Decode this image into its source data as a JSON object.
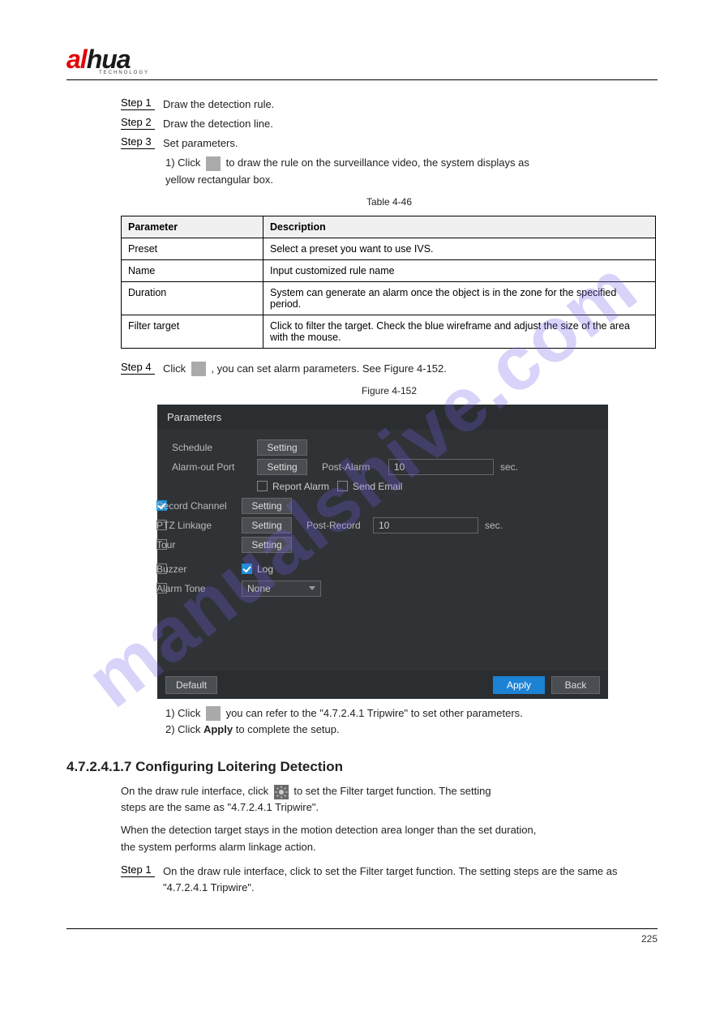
{
  "logo": {
    "brand": "alhua",
    "tagline": "TECHNOLOGY"
  },
  "watermark": "manualshive.com",
  "intro_steps": {
    "s1": {
      "n": "Step 1",
      "text": "Draw the detection rule."
    },
    "s2": {
      "n": "Step 2",
      "text": "Draw the detection line."
    },
    "s3": {
      "n": "Step 3",
      "text": "Set parameters."
    }
  },
  "icon_draw_instruction_prefix": "1)  Click ",
  "icon_draw_instruction_suffix": " to draw the rule on the surveillance video, the system displays as",
  "yellow_line": "yellow rectangular box.",
  "table_caption": "Table 4-46",
  "table": {
    "headers": {
      "param": "Parameter",
      "desc": "Description"
    },
    "rows": [
      {
        "param": "Preset",
        "desc": "Select a preset you want to use IVS."
      },
      {
        "param": "Name",
        "desc": "Input customized rule name"
      },
      {
        "param": "Duration",
        "desc": "System can generate an alarm once the object is in the zone for the specified period."
      },
      {
        "param": "Filter target",
        "desc": "Click to filter the target. Check the blue wireframe and adjust the size of the area with the mouse."
      }
    ]
  },
  "step4": {
    "n": "Step 4",
    "text_prefix": "Click ",
    "gear_icon_alt": "gear-icon",
    "text_after": ", you can set alarm parameters. See Figure 4-152."
  },
  "figure_caption": "Figure 4-152",
  "ui": {
    "title": "Parameters",
    "rows": {
      "schedule": {
        "label": "Schedule",
        "btn": "Setting"
      },
      "alarmout": {
        "label": "Alarm-out Port",
        "btn": "Setting",
        "post_label": "Post-Alarm",
        "value": "10",
        "unit": "sec."
      },
      "report": {
        "report_label": "Report Alarm",
        "email_label": "Send Email"
      },
      "record": {
        "label": "Record Channel",
        "btn": "Setting",
        "checked": true
      },
      "ptz": {
        "label": "PTZ Linkage",
        "btn": "Setting",
        "post_label": "Post-Record",
        "value": "10",
        "unit": "sec.",
        "checked": false
      },
      "tour": {
        "label": "Tour",
        "btn": "Setting",
        "checked": false
      },
      "buzzer": {
        "label": "Buzzer",
        "checked": false,
        "log_label": "Log",
        "log_checked": true
      },
      "alarmtone": {
        "label": "Alarm Tone",
        "checked": false,
        "select": "None"
      }
    },
    "footer": {
      "default": "Default",
      "apply": "Apply",
      "back": "Back"
    }
  },
  "after_steps": {
    "a1_prefix": "1)  Click ",
    "a1_mid": " you can refer to the \"4.7.2.4.1 Tripwire\" to set other parameters.",
    "a2_prefix": "2)  Click ",
    "a2_apply": "Apply",
    "a2_suffix": " to complete the setup."
  },
  "config_heading": "4.7.2.4.1.7 Configuring Loitering Detection",
  "config_body_l1": "When the detection target stays in the motion detection area longer than the set duration,",
  "config_body_l2": "the system performs alarm linkage action.",
  "gear_note_prefix": "On the draw rule interface, click ",
  "gear_note_suffix": " to set the Filter target function. The setting",
  "gear_note_l2": "steps are the same as \"4.7.2.4.1 Tripwire\".",
  "step5": {
    "n": "Step 1",
    "text": "On the draw rule interface, click to set the Filter target function. The setting steps are the same as \"4.7.2.4.1 Tripwire\"."
  },
  "footer_page": "225"
}
